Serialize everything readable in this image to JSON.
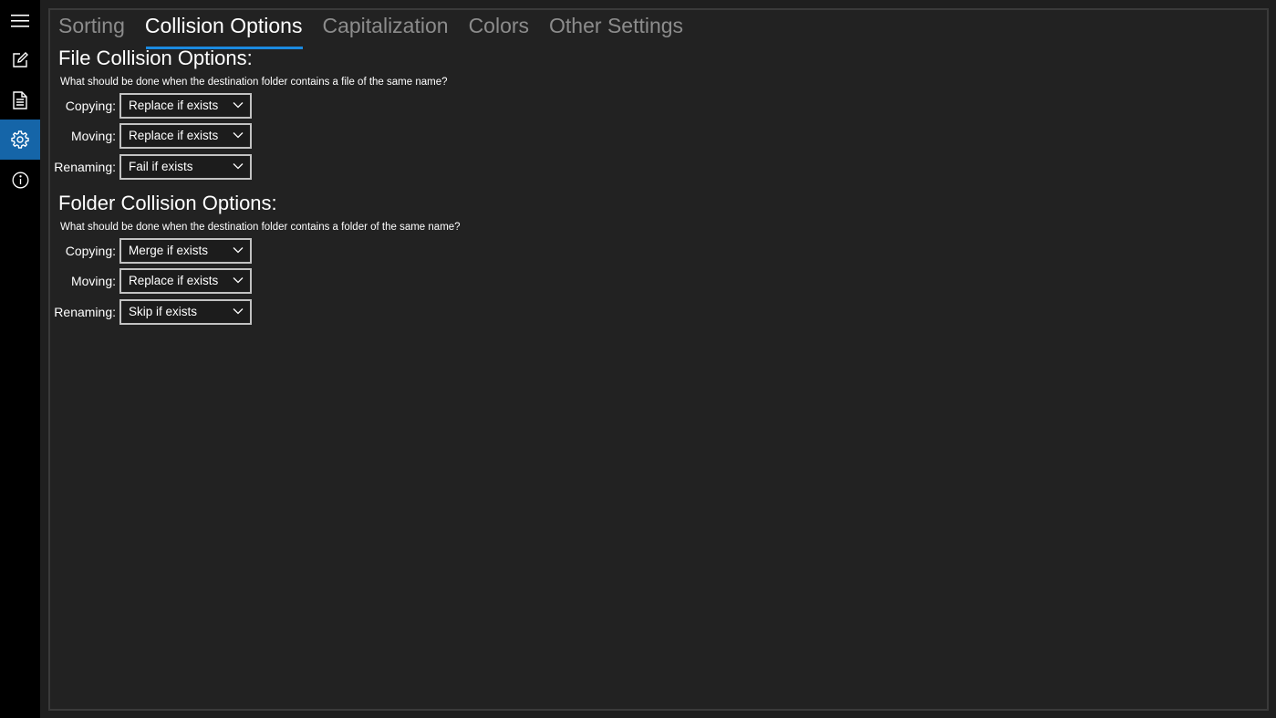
{
  "sidebar": {
    "items": [
      {
        "name": "menu",
        "icon": "hamburger-menu-icon",
        "active": false
      },
      {
        "name": "edit",
        "icon": "edit-icon",
        "active": false
      },
      {
        "name": "document",
        "icon": "document-icon",
        "active": false
      },
      {
        "name": "settings",
        "icon": "gear-icon",
        "active": true
      },
      {
        "name": "about",
        "icon": "info-icon",
        "active": false
      }
    ],
    "accent_color": "#1565a8"
  },
  "tabs": [
    {
      "label": "Sorting",
      "active": false
    },
    {
      "label": "Collision Options",
      "active": true
    },
    {
      "label": "Capitalization",
      "active": false
    },
    {
      "label": "Colors",
      "active": false
    },
    {
      "label": "Other Settings",
      "active": false
    }
  ],
  "file_section": {
    "title": "File Collision Options:",
    "description": "What should be done when the destination folder contains a file of the same name?",
    "rows": [
      {
        "label": "Copying:",
        "value": "Replace if exists"
      },
      {
        "label": "Moving:",
        "value": "Replace if exists"
      },
      {
        "label": "Renaming:",
        "value": "Fail if exists"
      }
    ]
  },
  "folder_section": {
    "title": "Folder Collision Options:",
    "description": "What should be done when the destination folder contains a folder of the same name?",
    "rows": [
      {
        "label": "Copying:",
        "value": "Merge if exists"
      },
      {
        "label": "Moving:",
        "value": "Replace if exists"
      },
      {
        "label": "Renaming:",
        "value": "Skip if exists"
      }
    ]
  }
}
